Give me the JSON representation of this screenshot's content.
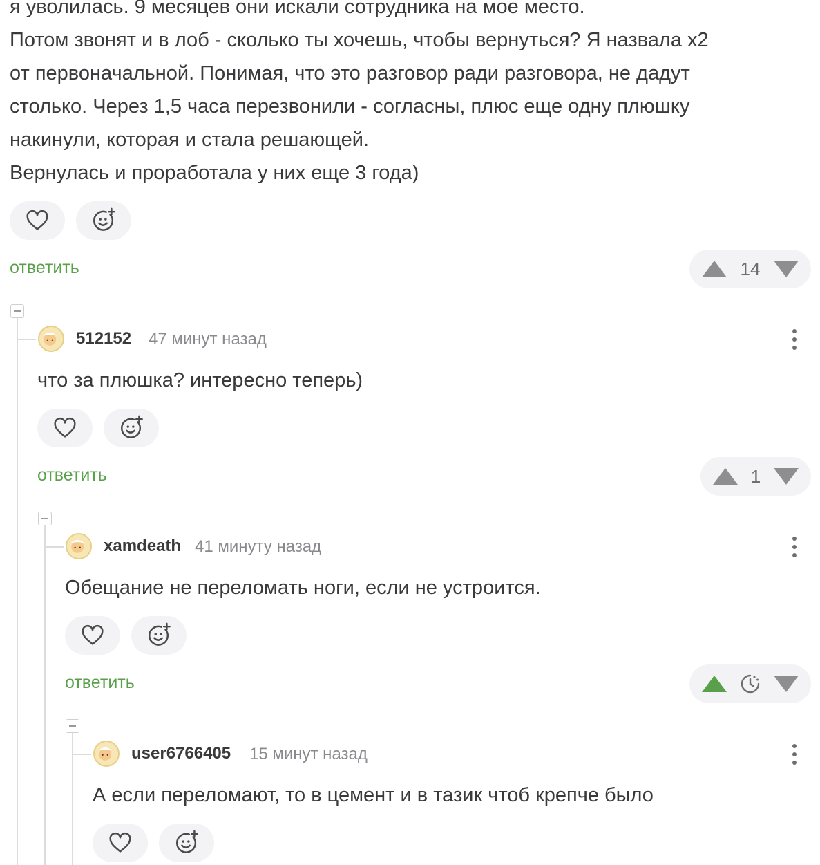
{
  "parent_comment": {
    "lines": [
      "я уволилась. 9 месяцев они искали сотрудника на мое место.",
      "Потом звонят и в лоб - сколько ты хочешь, чтобы вернуться? Я назвала х2",
      "от первоначальной. Понимая, что это разговор ради разговора, не дадут",
      "столько. Через 1,5 часа перезвонили - согласны, плюс еще одну плюшку",
      "накинули, которая и стала решающей.",
      "Вернулась и проработала у них еще 3 года)"
    ],
    "reply_label": "ответить",
    "rating": "14"
  },
  "comments": [
    {
      "username": "512152",
      "time": "47 минут назад",
      "text": "что за плюшка? интересно теперь)",
      "reply_label": "ответить",
      "rating": "1"
    },
    {
      "username": "xamdeath",
      "time": "41 минуту назад",
      "text": "Обещание не переломать ноги, если не устроится.",
      "reply_label": "ответить",
      "rating_icon": "clock-pending-icon",
      "upvoted": true
    },
    {
      "username": "user6766405",
      "time": "15 минут назад",
      "text": "А если переломают, то в цемент и в тазик чтоб крепче было"
    }
  ],
  "colors": {
    "accent_green": "#5aa04a",
    "text": "#3a3a3c",
    "muted": "#8a8a8e",
    "pill_bg": "#f3f3f5"
  }
}
